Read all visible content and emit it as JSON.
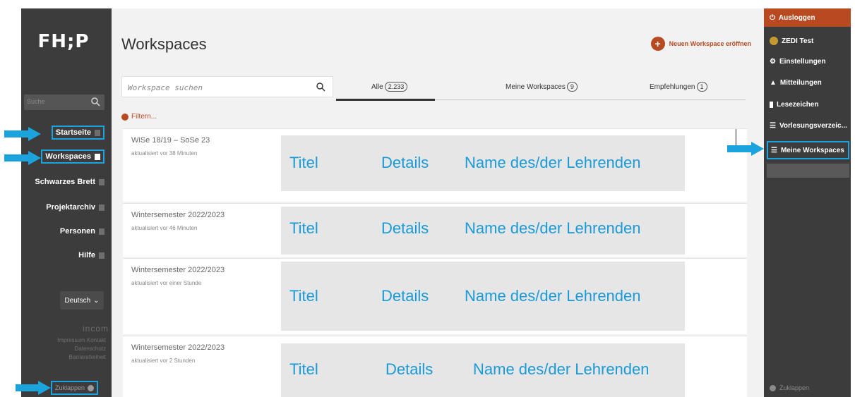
{
  "left_sidebar": {
    "logo": "FH;P",
    "search_placeholder": "Suche",
    "nav": [
      {
        "label": "Startseite"
      },
      {
        "label": "Workspaces"
      },
      {
        "label": "Schwarzes Brett"
      },
      {
        "label": "Projektarchiv"
      },
      {
        "label": "Personen"
      },
      {
        "label": "Hilfe"
      }
    ],
    "language": "Deutsch",
    "brand": "incom",
    "footer_line1": "Impressum Kontakt",
    "footer_line2": "Datenschutz",
    "footer_line3": "Barrierefreiheit",
    "collapse": "Zuklappen"
  },
  "main": {
    "title": "Workspaces",
    "new_workspace": "Neuen Workspace eröffnen",
    "search_placeholder": "Workspace suchen",
    "tabs": [
      {
        "label": "Alle",
        "count": "2.233"
      },
      {
        "label": "Meine Workspaces",
        "count": "9"
      },
      {
        "label": "Empfehlungen",
        "count": "1"
      }
    ],
    "filter": "Filtern...",
    "cards": [
      {
        "semester": "WiSe 18/19 – SoSe 23",
        "updated": "aktualisiert vor 38 Minuten",
        "title": "Titel",
        "details": "Details",
        "teacher": "Name des/der Lehrenden"
      },
      {
        "semester": "Wintersemester 2022/2023",
        "updated": "aktualisiert vor 46 Minuten",
        "title": "Titel",
        "details": "Details",
        "teacher": "Name des/der Lehrenden"
      },
      {
        "semester": "Wintersemester 2022/2023",
        "updated": "aktualisiert vor einer Stunde",
        "title": "Titel",
        "details": "Details",
        "teacher": "Name des/der Lehrenden"
      },
      {
        "semester": "Wintersemester 2022/2023",
        "updated": "aktualisiert vor 2 Stunden",
        "title": "Titel",
        "details": "Details",
        "teacher": "Name des/der Lehrenden"
      }
    ]
  },
  "right_sidebar": {
    "logout": "Ausloggen",
    "user": "ZEDI Test",
    "settings": "Einstellungen",
    "notifications": "Mitteilungen",
    "bookmarks": "Lesezeichen",
    "course_catalog": "Vorlesungsverzeic...",
    "my_workspaces": "Meine Workspaces",
    "collapse": "Zuklappen"
  },
  "colors": {
    "accent": "#b84a22",
    "highlight": "#1aa3dd",
    "sidebar": "#3c3c3c",
    "placeholder_text": "#1a9ad6"
  }
}
